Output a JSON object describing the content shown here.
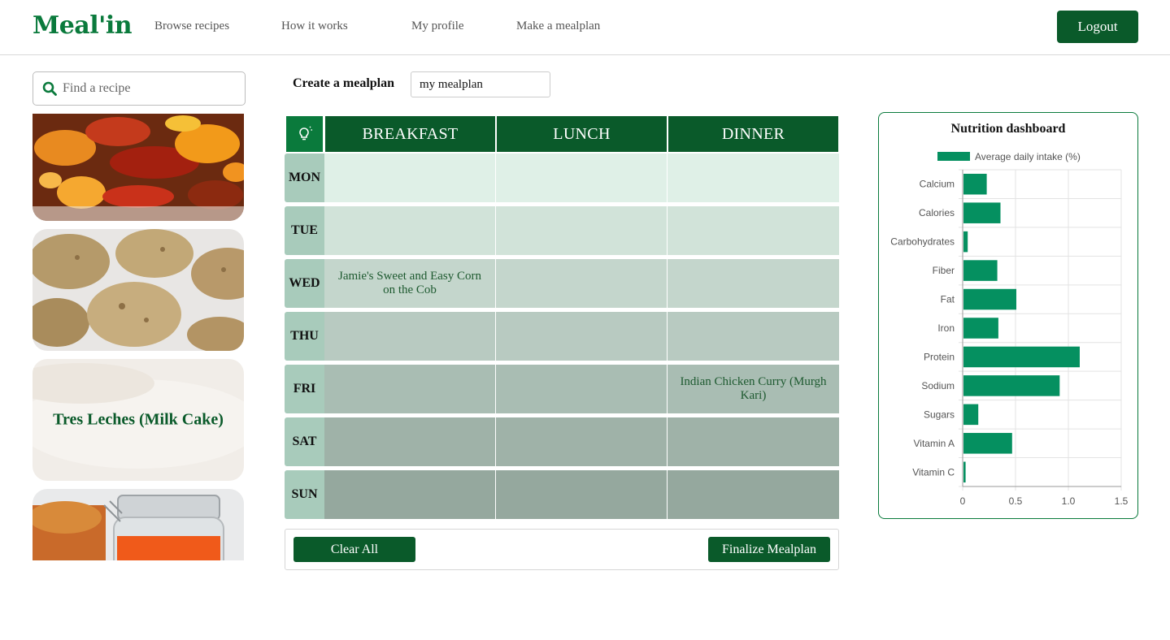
{
  "header": {
    "logo": "Meal'in",
    "nav": [
      "Browse recipes",
      "How it works",
      "My profile",
      "Make a mealplan"
    ],
    "logout_label": "Logout"
  },
  "sidebar": {
    "search_placeholder": "Find a recipe",
    "cards": [
      {
        "title": "",
        "image": "roasted-chicken-vegetables"
      },
      {
        "title": "",
        "image": "oatmeal-cookies"
      },
      {
        "title": "Tres Leches (Milk Cake)",
        "image": "milk-cake-faded"
      },
      {
        "title": "",
        "image": "chicken-with-sauce-jar"
      }
    ]
  },
  "mealplan": {
    "create_label": "Create a mealplan",
    "name_value": "my mealplan",
    "tip_icon": "lightbulb-icon",
    "meals": [
      "BREAKFAST",
      "LUNCH",
      "DINNER"
    ],
    "days": [
      {
        "label": "MON",
        "cells": [
          "",
          "",
          ""
        ]
      },
      {
        "label": "TUE",
        "cells": [
          "",
          "",
          ""
        ]
      },
      {
        "label": "WED",
        "cells": [
          "Jamie's Sweet and Easy Corn on the Cob",
          "",
          ""
        ]
      },
      {
        "label": "THU",
        "cells": [
          "",
          "",
          ""
        ]
      },
      {
        "label": "FRI",
        "cells": [
          "",
          "",
          "Indian Chicken Curry (Murgh Kari)"
        ]
      },
      {
        "label": "SAT",
        "cells": [
          "",
          "",
          ""
        ]
      },
      {
        "label": "SUN",
        "cells": [
          "",
          "",
          ""
        ]
      }
    ],
    "clear_label": "Clear All",
    "finalize_label": "Finalize Mealplan"
  },
  "colors": {
    "brand": "#0a7a3c",
    "dark_green": "#0a5a2a",
    "bar": "#059060",
    "row_fills": [
      "#dff0e7",
      "#d1e3d9",
      "#c4d6cc",
      "#b8cac1",
      "#a9bdb3",
      "#9fb2a8",
      "#95a89e"
    ]
  },
  "nutrition": {
    "title": "Nutrition dashboard",
    "chart_data": {
      "type": "bar",
      "orientation": "horizontal",
      "title": "Nutrition dashboard",
      "legend": "Average daily intake (%)",
      "legend_position": "top",
      "categories": [
        "Calcium",
        "Calories",
        "Carbohydrates",
        "Fiber",
        "Fat",
        "Iron",
        "Protein",
        "Sodium",
        "Sugars",
        "Vitamin A",
        "Vitamin C"
      ],
      "values": [
        0.22,
        0.35,
        0.04,
        0.32,
        0.5,
        0.33,
        1.1,
        0.91,
        0.14,
        0.46,
        0.02
      ],
      "xlim": [
        0,
        1.5
      ],
      "xticks": [
        "0",
        "0.5",
        "1.0",
        "1.5"
      ],
      "grid": true
    }
  }
}
